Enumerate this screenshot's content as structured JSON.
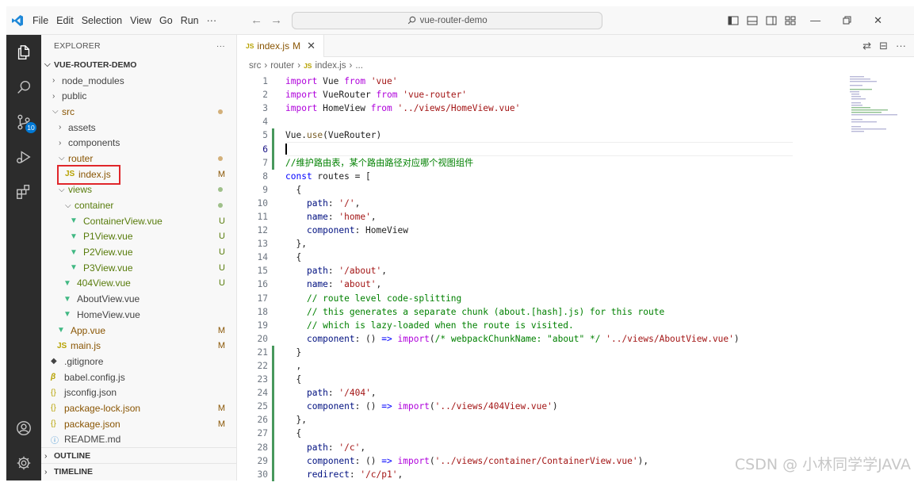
{
  "titlebar": {
    "menu": [
      "File",
      "Edit",
      "Selection",
      "View",
      "Go",
      "Run",
      "···"
    ],
    "search_text": "vue-router-demo",
    "minimize": "—",
    "close": "✕"
  },
  "activitybar": {
    "scm_badge": "10"
  },
  "sidebar": {
    "title": "EXPLORER",
    "more": "···",
    "root": "VUE-ROUTER-DEMO",
    "items": [
      {
        "label": "node_modules",
        "status": ""
      },
      {
        "label": "public",
        "status": ""
      },
      {
        "label": "src",
        "status": "dot"
      },
      {
        "label": "assets",
        "status": ""
      },
      {
        "label": "components",
        "status": ""
      },
      {
        "label": "router",
        "status": "dot"
      },
      {
        "label": "index.js",
        "status": "M"
      },
      {
        "label": "views",
        "status": "dot"
      },
      {
        "label": "container",
        "status": "dot"
      },
      {
        "label": "ContainerView.vue",
        "status": "U"
      },
      {
        "label": "P1View.vue",
        "status": "U"
      },
      {
        "label": "P2View.vue",
        "status": "U"
      },
      {
        "label": "P3View.vue",
        "status": "U"
      },
      {
        "label": "404View.vue",
        "status": "U"
      },
      {
        "label": "AboutView.vue",
        "status": ""
      },
      {
        "label": "HomeView.vue",
        "status": ""
      },
      {
        "label": "App.vue",
        "status": "M"
      },
      {
        "label": "main.js",
        "status": "M"
      },
      {
        "label": ".gitignore",
        "status": ""
      },
      {
        "label": "babel.config.js",
        "status": ""
      },
      {
        "label": "jsconfig.json",
        "status": ""
      },
      {
        "label": "package-lock.json",
        "status": "M"
      },
      {
        "label": "package.json",
        "status": "M"
      },
      {
        "label": "README.md",
        "status": ""
      }
    ],
    "outline": "OUTLINE",
    "timeline": "TIMELINE"
  },
  "editor": {
    "tab_label": "index.js",
    "tab_status": "M",
    "tab_icon": "JS",
    "breadcrumb": [
      "src",
      "router",
      "index.js",
      "..."
    ],
    "code_lines": [
      "import Vue from 'vue'",
      "import VueRouter from 'vue-router'",
      "import HomeView from '../views/HomeView.vue'",
      "",
      "Vue.use(VueRouter)",
      "",
      "//维护路由表，某个路由路径对应哪个视图组件",
      "const routes = [",
      "  {",
      "    path: '/',",
      "    name: 'home',",
      "    component: HomeView",
      "  },",
      "  {",
      "    path: '/about',",
      "    name: 'about',",
      "    // route level code-splitting",
      "    // this generates a separate chunk (about.[hash].js) for this route",
      "    // which is lazy-loaded when the route is visited.",
      "    component: () => import(/* webpackChunkName: \"about\" */ '../views/AboutView.vue')",
      "  }",
      "  ,",
      "  {",
      "    path: '/404',",
      "    component: () => import('../views/404View.vue')",
      "  },",
      "  {",
      "    path: '/c',",
      "    component: () => import('../views/container/ContainerView.vue'),",
      "    redirect: '/c/p1',"
    ],
    "current_line": 6
  },
  "watermark": "CSDN @ 小林同学学JAVA"
}
